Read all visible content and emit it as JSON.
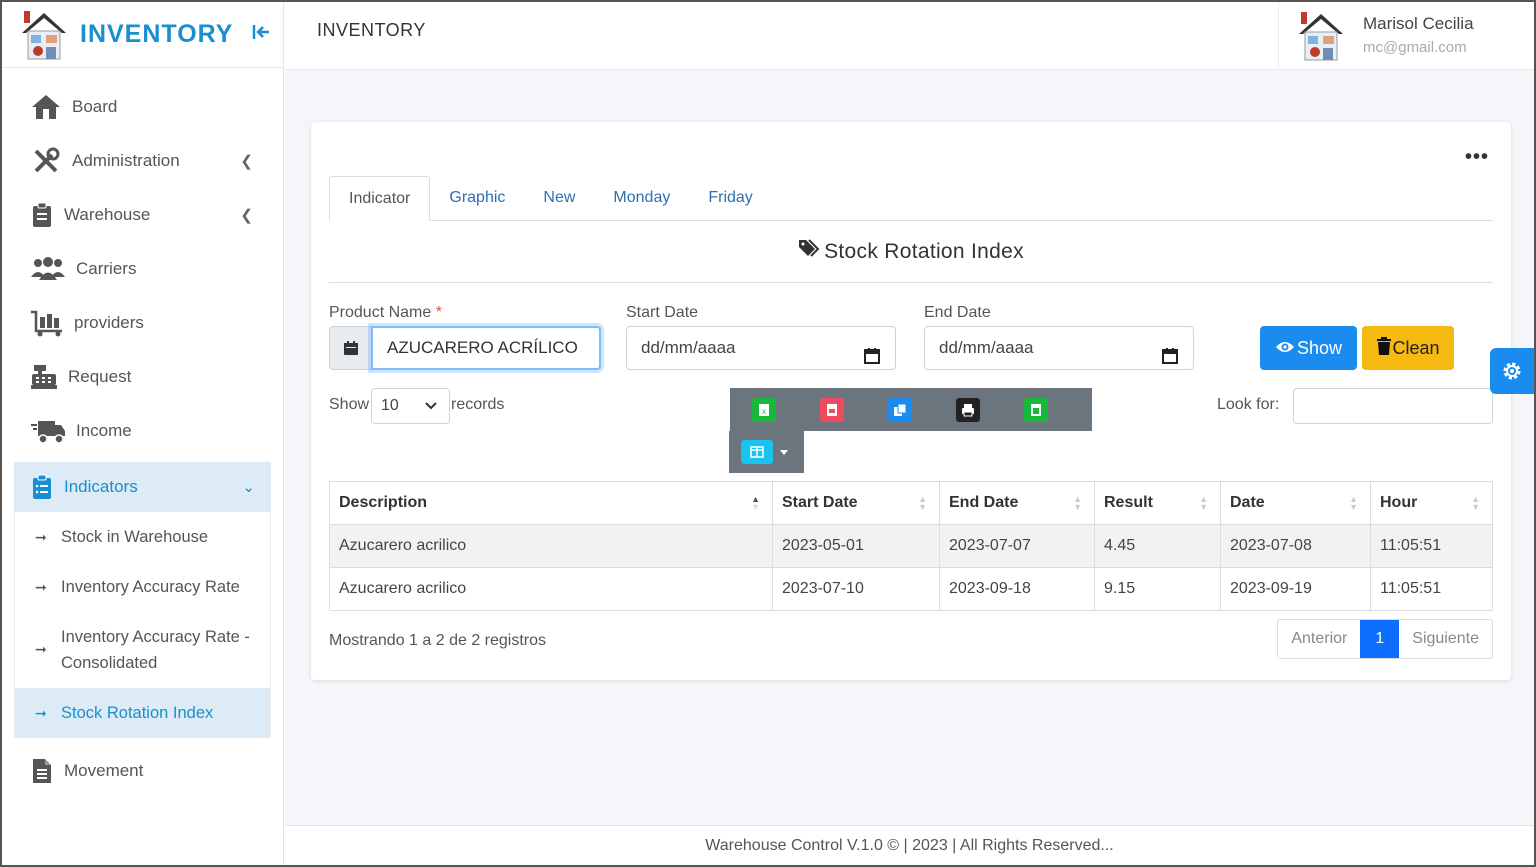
{
  "brand": {
    "title": "INVENTORY",
    "collapse_icon": "collapse-left-icon"
  },
  "header": {
    "title": "INVENTORY"
  },
  "user": {
    "name": "Marisol Cecilia",
    "email": "mc@gmail.com"
  },
  "sidebar": {
    "items": [
      {
        "label": "Board",
        "icon": "home-icon"
      },
      {
        "label": "Administration",
        "icon": "tools-icon"
      },
      {
        "label": "Warehouse",
        "icon": "clipboard-icon"
      },
      {
        "label": "Carriers",
        "icon": "users-icon"
      },
      {
        "label": "providers",
        "icon": "cart-icon"
      },
      {
        "label": "Request",
        "icon": "cash-register-icon"
      },
      {
        "label": "Income",
        "icon": "truck-icon"
      },
      {
        "label": "Indicators",
        "icon": "clipboard-list-icon"
      },
      {
        "label": "Movement",
        "icon": "file-icon"
      }
    ],
    "submenu": [
      {
        "label": "Stock in Warehouse"
      },
      {
        "label": "Inventory Accuracy Rate"
      },
      {
        "label": "Inventory Accuracy Rate - Consolidated"
      },
      {
        "label": "Stock Rotation Index"
      }
    ]
  },
  "tabs": [
    {
      "label": "Indicator"
    },
    {
      "label": "Graphic"
    },
    {
      "label": "New"
    },
    {
      "label": "Monday"
    },
    {
      "label": "Friday"
    }
  ],
  "section_title": "Stock Rotation Index",
  "form": {
    "product_label": "Product Name",
    "required_mark": "*",
    "product_value": "AZUCARERO ACRÍLICO",
    "start_label": "Start Date",
    "start_value": "dd/mm/aaaa",
    "end_label": "End Date",
    "end_value": "dd/mm/aaaa",
    "show_btn": "Show",
    "clean_btn": "Clean"
  },
  "table_controls": {
    "show_label": "Show",
    "length_value": "10",
    "records_label": "records",
    "search_label": "Look for:",
    "search_value": ""
  },
  "table": {
    "headers": [
      "Description",
      "Start Date",
      "End Date",
      "Result",
      "Date",
      "Hour"
    ],
    "rows": [
      [
        "Azucarero acrilico",
        "2023-05-01",
        "2023-07-07",
        "4.45",
        "2023-07-08",
        "11:05:51"
      ],
      [
        "Azucarero acrilico",
        "2023-07-10",
        "2023-09-18",
        "9.15",
        "2023-09-19",
        "11:05:51"
      ]
    ]
  },
  "pagination": {
    "info": "Mostrando 1 a 2 de 2 registros",
    "prev": "Anterior",
    "page": "1",
    "next": "Siguiente"
  },
  "footer": "Warehouse Control V.1.0 © | 2023 | All Rights Reserved...",
  "colors": {
    "accent": "#1a8fd0",
    "show_button": "#1a8cf0",
    "clean_button": "#f5b90f",
    "page_active": "#0d6efd"
  }
}
